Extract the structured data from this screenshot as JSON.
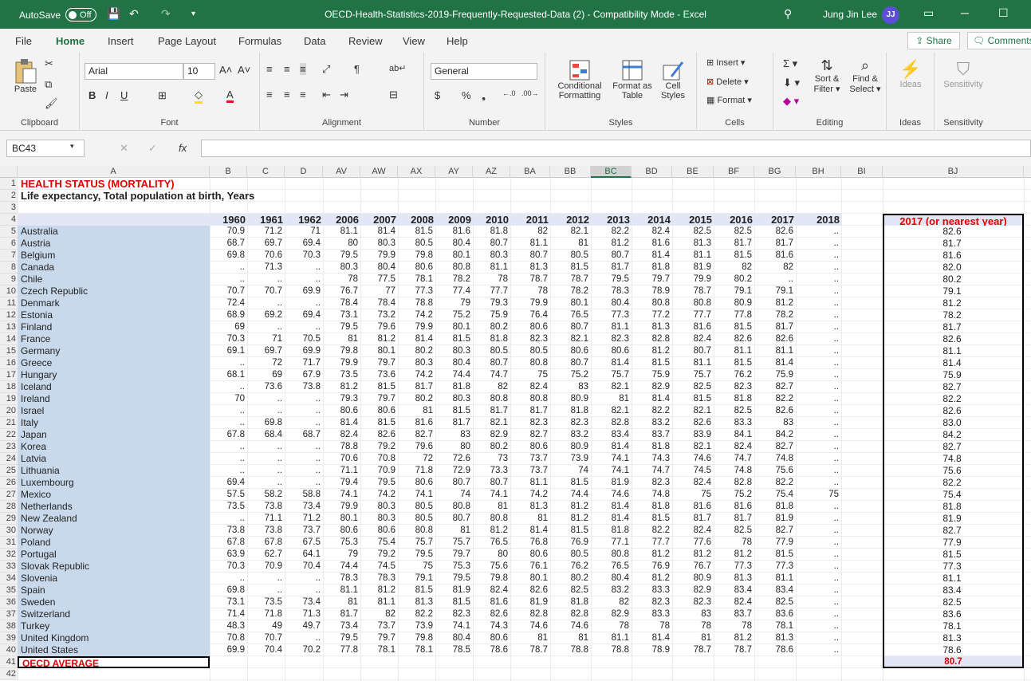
{
  "window": {
    "autosave_label": "AutoSave",
    "autosave_state": "Off",
    "title": "OECD-Health-Statistics-2019-Frequently-Requested-Data (2)  -  Compatibility Mode  -  Excel",
    "user_name": "Jung Jin Lee",
    "user_initials": "JJ"
  },
  "menu": {
    "tabs": [
      "File",
      "Home",
      "Insert",
      "Page Layout",
      "Formulas",
      "Data",
      "Review",
      "View",
      "Help"
    ],
    "active": "Home",
    "share": "Share",
    "comments": "Comments"
  },
  "ribbon": {
    "clipboard": {
      "label": "Clipboard",
      "paste": "Paste"
    },
    "font": {
      "label": "Font",
      "name": "Arial",
      "size": "10"
    },
    "alignment": {
      "label": "Alignment"
    },
    "number": {
      "label": "Number",
      "format": "General"
    },
    "styles": {
      "label": "Styles",
      "conditional": "Conditional",
      "formatting": "Formatting",
      "format_as": "Format as",
      "table": "Table",
      "cell": "Cell",
      "styles_btn": "Styles"
    },
    "cells": {
      "label": "Cells",
      "insert": "Insert",
      "delete": "Delete",
      "format": "Format"
    },
    "editing": {
      "label": "Editing",
      "sort": "Sort &",
      "filter": "Filter",
      "find": "Find &",
      "select": "Select"
    },
    "ideas": {
      "label": "Ideas",
      "btn": "Ideas"
    },
    "sensitivity": {
      "label": "Sensitivity",
      "btn": "Sensitivity"
    }
  },
  "formula_bar": {
    "name_box": "BC43",
    "fx": "fx",
    "value": ""
  },
  "sheet": {
    "columns": [
      "A",
      "B",
      "C",
      "D",
      "AV",
      "AW",
      "AX",
      "AY",
      "AZ",
      "BA",
      "BB",
      "BC",
      "BD",
      "BE",
      "BF",
      "BG",
      "BH",
      "BI",
      "BJ"
    ],
    "selected_column": "BC",
    "title": "HEALTH STATUS (MORTALITY)",
    "subtitle": "Life expectancy, Total population at birth, Years",
    "years": [
      "1960",
      "1961",
      "1962",
      "2006",
      "2007",
      "2008",
      "2009",
      "2010",
      "2011",
      "2012",
      "2013",
      "2014",
      "2015",
      "2016",
      "2017",
      "2018"
    ],
    "bj_header": "2017 (or nearest year)",
    "countries": [
      {
        "name": "Australia",
        "v": [
          "70.9",
          "71.2",
          "71",
          "81.1",
          "81.4",
          "81.5",
          "81.6",
          "81.8",
          "82",
          "82.1",
          "82.2",
          "82.4",
          "82.5",
          "82.5",
          "82.6",
          ".."
        ],
        "bj": "82.6"
      },
      {
        "name": "Austria",
        "v": [
          "68.7",
          "69.7",
          "69.4",
          "80",
          "80.3",
          "80.5",
          "80.4",
          "80.7",
          "81.1",
          "81",
          "81.2",
          "81.6",
          "81.3",
          "81.7",
          "81.7",
          ".."
        ],
        "bj": "81.7"
      },
      {
        "name": "Belgium",
        "v": [
          "69.8",
          "70.6",
          "70.3",
          "79.5",
          "79.9",
          "79.8",
          "80.1",
          "80.3",
          "80.7",
          "80.5",
          "80.7",
          "81.4",
          "81.1",
          "81.5",
          "81.6",
          ".."
        ],
        "bj": "81.6"
      },
      {
        "name": "Canada",
        "v": [
          "..",
          "71.3",
          "..",
          "80.3",
          "80.4",
          "80.6",
          "80.8",
          "81.1",
          "81.3",
          "81.5",
          "81.7",
          "81.8",
          "81.9",
          "82",
          "82",
          ".."
        ],
        "bj": "82.0"
      },
      {
        "name": "Chile",
        "v": [
          "..",
          "..",
          "..",
          "78",
          "77.5",
          "78.1",
          "78.2",
          "78",
          "78.7",
          "78.7",
          "79.5",
          "79.7",
          "79.9",
          "80.2",
          "..",
          ".."
        ],
        "bj": "80.2"
      },
      {
        "name": "Czech Republic",
        "v": [
          "70.7",
          "70.7",
          "69.9",
          "76.7",
          "77",
          "77.3",
          "77.4",
          "77.7",
          "78",
          "78.2",
          "78.3",
          "78.9",
          "78.7",
          "79.1",
          "79.1",
          ".."
        ],
        "bj": "79.1"
      },
      {
        "name": "Denmark",
        "v": [
          "72.4",
          "..",
          "..",
          "78.4",
          "78.4",
          "78.8",
          "79",
          "79.3",
          "79.9",
          "80.1",
          "80.4",
          "80.8",
          "80.8",
          "80.9",
          "81.2",
          ".."
        ],
        "bj": "81.2"
      },
      {
        "name": "Estonia",
        "v": [
          "68.9",
          "69.2",
          "69.4",
          "73.1",
          "73.2",
          "74.2",
          "75.2",
          "75.9",
          "76.4",
          "76.5",
          "77.3",
          "77.2",
          "77.7",
          "77.8",
          "78.2",
          ".."
        ],
        "bj": "78.2"
      },
      {
        "name": "Finland",
        "v": [
          "69",
          "..",
          "..",
          "79.5",
          "79.6",
          "79.9",
          "80.1",
          "80.2",
          "80.6",
          "80.7",
          "81.1",
          "81.3",
          "81.6",
          "81.5",
          "81.7",
          ".."
        ],
        "bj": "81.7"
      },
      {
        "name": "France",
        "v": [
          "70.3",
          "71",
          "70.5",
          "81",
          "81.2",
          "81.4",
          "81.5",
          "81.8",
          "82.3",
          "82.1",
          "82.3",
          "82.8",
          "82.4",
          "82.6",
          "82.6",
          ".."
        ],
        "bj": "82.6"
      },
      {
        "name": "Germany",
        "v": [
          "69.1",
          "69.7",
          "69.9",
          "79.8",
          "80.1",
          "80.2",
          "80.3",
          "80.5",
          "80.5",
          "80.6",
          "80.6",
          "81.2",
          "80.7",
          "81.1",
          "81.1",
          ".."
        ],
        "bj": "81.1"
      },
      {
        "name": "Greece",
        "v": [
          "..",
          "72",
          "71.7",
          "79.9",
          "79.7",
          "80.3",
          "80.4",
          "80.7",
          "80.8",
          "80.7",
          "81.4",
          "81.5",
          "81.1",
          "81.5",
          "81.4",
          ".."
        ],
        "bj": "81.4"
      },
      {
        "name": "Hungary",
        "v": [
          "68.1",
          "69",
          "67.9",
          "73.5",
          "73.6",
          "74.2",
          "74.4",
          "74.7",
          "75",
          "75.2",
          "75.7",
          "75.9",
          "75.7",
          "76.2",
          "75.9",
          ".."
        ],
        "bj": "75.9"
      },
      {
        "name": "Iceland",
        "v": [
          "..",
          "73.6",
          "73.8",
          "81.2",
          "81.5",
          "81.7",
          "81.8",
          "82",
          "82.4",
          "83",
          "82.1",
          "82.9",
          "82.5",
          "82.3",
          "82.7",
          ".."
        ],
        "bj": "82.7"
      },
      {
        "name": "Ireland",
        "v": [
          "70",
          "..",
          "..",
          "79.3",
          "79.7",
          "80.2",
          "80.3",
          "80.8",
          "80.8",
          "80.9",
          "81",
          "81.4",
          "81.5",
          "81.8",
          "82.2",
          ".."
        ],
        "bj": "82.2"
      },
      {
        "name": "Israel",
        "v": [
          "..",
          "..",
          "..",
          "80.6",
          "80.6",
          "81",
          "81.5",
          "81.7",
          "81.7",
          "81.8",
          "82.1",
          "82.2",
          "82.1",
          "82.5",
          "82.6",
          ".."
        ],
        "bj": "82.6"
      },
      {
        "name": "Italy",
        "v": [
          "..",
          "69.8",
          "..",
          "81.4",
          "81.5",
          "81.6",
          "81.7",
          "82.1",
          "82.3",
          "82.3",
          "82.8",
          "83.2",
          "82.6",
          "83.3",
          "83",
          ".."
        ],
        "bj": "83.0"
      },
      {
        "name": "Japan",
        "v": [
          "67.8",
          "68.4",
          "68.7",
          "82.4",
          "82.6",
          "82.7",
          "83",
          "82.9",
          "82.7",
          "83.2",
          "83.4",
          "83.7",
          "83.9",
          "84.1",
          "84.2",
          ".."
        ],
        "bj": "84.2"
      },
      {
        "name": "Korea",
        "v": [
          "..",
          "..",
          "..",
          "78.8",
          "79.2",
          "79.6",
          "80",
          "80.2",
          "80.6",
          "80.9",
          "81.4",
          "81.8",
          "82.1",
          "82.4",
          "82.7",
          ".."
        ],
        "bj": "82.7"
      },
      {
        "name": "Latvia",
        "v": [
          "..",
          "..",
          "..",
          "70.6",
          "70.8",
          "72",
          "72.6",
          "73",
          "73.7",
          "73.9",
          "74.1",
          "74.3",
          "74.6",
          "74.7",
          "74.8",
          ".."
        ],
        "bj": "74.8"
      },
      {
        "name": "Lithuania",
        "v": [
          "..",
          "..",
          "..",
          "71.1",
          "70.9",
          "71.8",
          "72.9",
          "73.3",
          "73.7",
          "74",
          "74.1",
          "74.7",
          "74.5",
          "74.8",
          "75.6",
          ".."
        ],
        "bj": "75.6"
      },
      {
        "name": "Luxembourg",
        "v": [
          "69.4",
          "..",
          "..",
          "79.4",
          "79.5",
          "80.6",
          "80.7",
          "80.7",
          "81.1",
          "81.5",
          "81.9",
          "82.3",
          "82.4",
          "82.8",
          "82.2",
          ".."
        ],
        "bj": "82.2"
      },
      {
        "name": "Mexico",
        "v": [
          "57.5",
          "58.2",
          "58.8",
          "74.1",
          "74.2",
          "74.1",
          "74",
          "74.1",
          "74.2",
          "74.4",
          "74.6",
          "74.8",
          "75",
          "75.2",
          "75.4",
          "75"
        ],
        "bj": "75.4"
      },
      {
        "name": "Netherlands",
        "v": [
          "73.5",
          "73.8",
          "73.4",
          "79.9",
          "80.3",
          "80.5",
          "80.8",
          "81",
          "81.3",
          "81.2",
          "81.4",
          "81.8",
          "81.6",
          "81.6",
          "81.8",
          ".."
        ],
        "bj": "81.8"
      },
      {
        "name": "New Zealand",
        "v": [
          "..",
          "71.1",
          "71.2",
          "80.1",
          "80.3",
          "80.5",
          "80.7",
          "80.8",
          "81",
          "81.2",
          "81.4",
          "81.5",
          "81.7",
          "81.7",
          "81.9",
          ".."
        ],
        "bj": "81.9"
      },
      {
        "name": "Norway",
        "v": [
          "73.8",
          "73.8",
          "73.7",
          "80.6",
          "80.6",
          "80.8",
          "81",
          "81.2",
          "81.4",
          "81.5",
          "81.8",
          "82.2",
          "82.4",
          "82.5",
          "82.7",
          ".."
        ],
        "bj": "82.7"
      },
      {
        "name": "Poland",
        "v": [
          "67.8",
          "67.8",
          "67.5",
          "75.3",
          "75.4",
          "75.7",
          "75.7",
          "76.5",
          "76.8",
          "76.9",
          "77.1",
          "77.7",
          "77.6",
          "78",
          "77.9",
          ".."
        ],
        "bj": "77.9"
      },
      {
        "name": "Portugal",
        "v": [
          "63.9",
          "62.7",
          "64.1",
          "79",
          "79.2",
          "79.5",
          "79.7",
          "80",
          "80.6",
          "80.5",
          "80.8",
          "81.2",
          "81.2",
          "81.2",
          "81.5",
          ".."
        ],
        "bj": "81.5"
      },
      {
        "name": "Slovak Republic",
        "v": [
          "70.3",
          "70.9",
          "70.4",
          "74.4",
          "74.5",
          "75",
          "75.3",
          "75.6",
          "76.1",
          "76.2",
          "76.5",
          "76.9",
          "76.7",
          "77.3",
          "77.3",
          ".."
        ],
        "bj": "77.3"
      },
      {
        "name": "Slovenia",
        "v": [
          "..",
          "..",
          "..",
          "78.3",
          "78.3",
          "79.1",
          "79.5",
          "79.8",
          "80.1",
          "80.2",
          "80.4",
          "81.2",
          "80.9",
          "81.3",
          "81.1",
          ".."
        ],
        "bj": "81.1"
      },
      {
        "name": "Spain",
        "v": [
          "69.8",
          "..",
          "..",
          "81.1",
          "81.2",
          "81.5",
          "81.9",
          "82.4",
          "82.6",
          "82.5",
          "83.2",
          "83.3",
          "82.9",
          "83.4",
          "83.4",
          ".."
        ],
        "bj": "83.4"
      },
      {
        "name": "Sweden",
        "v": [
          "73.1",
          "73.5",
          "73.4",
          "81",
          "81.1",
          "81.3",
          "81.5",
          "81.6",
          "81.9",
          "81.8",
          "82",
          "82.3",
          "82.3",
          "82.4",
          "82.5",
          ".."
        ],
        "bj": "82.5"
      },
      {
        "name": "Switzerland",
        "v": [
          "71.4",
          "71.8",
          "71.3",
          "81.7",
          "82",
          "82.2",
          "82.3",
          "82.6",
          "82.8",
          "82.8",
          "82.9",
          "83.3",
          "83",
          "83.7",
          "83.6",
          ".."
        ],
        "bj": "83.6"
      },
      {
        "name": "Turkey",
        "v": [
          "48.3",
          "49",
          "49.7",
          "73.4",
          "73.7",
          "73.9",
          "74.1",
          "74.3",
          "74.6",
          "74.6",
          "78",
          "78",
          "78",
          "78",
          "78.1",
          ".."
        ],
        "bj": "78.1"
      },
      {
        "name": "United Kingdom",
        "v": [
          "70.8",
          "70.7",
          "..",
          "79.5",
          "79.7",
          "79.8",
          "80.4",
          "80.6",
          "81",
          "81",
          "81.1",
          "81.4",
          "81",
          "81.2",
          "81.3",
          ".."
        ],
        "bj": "81.3"
      },
      {
        "name": "United States",
        "v": [
          "69.9",
          "70.4",
          "70.2",
          "77.8",
          "78.1",
          "78.1",
          "78.5",
          "78.6",
          "78.7",
          "78.8",
          "78.8",
          "78.9",
          "78.7",
          "78.7",
          "78.6",
          ".."
        ],
        "bj": "78.6"
      }
    ],
    "oecd_average_label": "OECD AVERAGE",
    "oecd_average_value": "80.7",
    "row_count": 42
  }
}
